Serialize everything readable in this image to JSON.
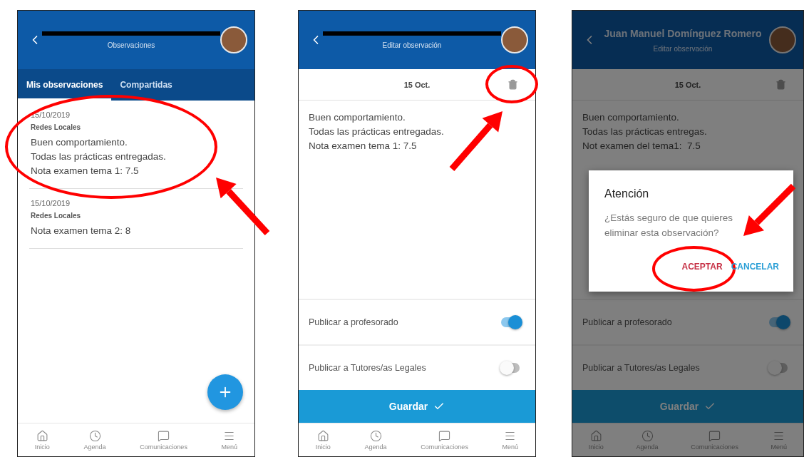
{
  "screens": [
    {
      "kind": "list",
      "header": {
        "redacted": true,
        "subtitle": "Observaciones"
      },
      "tabs": [
        {
          "label": "Mis observaciones",
          "selected": true
        },
        {
          "label": "Compartidas",
          "selected": false
        }
      ],
      "items": [
        {
          "date": "15/10/2019",
          "subject": "Redes Locales",
          "text": "Buen comportamiento.\nTodas las prácticas entregadas.\nNota examen tema 1: 7.5",
          "highlighted": true
        },
        {
          "date": "15/10/2019",
          "subject": "Redes Locales",
          "text": "Nota examen tema 2: 8",
          "highlighted": false
        }
      ],
      "nav": [
        {
          "label": "Inicio"
        },
        {
          "label": "Agenda"
        },
        {
          "label": "Comunicaciones"
        },
        {
          "label": "Menú"
        }
      ]
    },
    {
      "kind": "edit",
      "header": {
        "redacted": true,
        "subtitle": "Editar observación"
      },
      "date": "15 Oct.",
      "trash": {
        "highlighted": true
      },
      "note": "Buen comportamiento.\nTodas las prácticas entregadas.\nNota examen tema 1: 7.5",
      "toggles": [
        {
          "label": "Publicar a profesorado",
          "on": true
        },
        {
          "label": "Publicar a Tutores/as Legales",
          "on": false
        }
      ],
      "save_label": "Guardar",
      "nav": [
        {
          "label": "Inicio"
        },
        {
          "label": "Agenda"
        },
        {
          "label": "Comunicaciones"
        },
        {
          "label": "Menú"
        }
      ]
    },
    {
      "kind": "edit",
      "dimmed": true,
      "header": {
        "redacted": false,
        "title": "Juan Manuel Domínguez Romero",
        "subtitle": "Editar observación"
      },
      "date": "15 Oct.",
      "note": "Buen comportamiento.\nTodas las prácticas entregas.\nNot examen del tema1:  7.5",
      "toggles": [
        {
          "label": "Publicar a profesorado",
          "on": true
        },
        {
          "label": "Publicar a Tutores/as Legales",
          "on": false
        }
      ],
      "save_label": "Guardar",
      "dialog": {
        "title": "Atención",
        "message": "¿Estás seguro de que quieres eliminar esta observación?",
        "buttons": [
          {
            "label": "ACEPTAR",
            "color": "#c62f44",
            "highlighted": true
          },
          {
            "label": "CANCELAR",
            "color": "#2a9fd6",
            "highlighted": false
          }
        ]
      },
      "nav": [
        {
          "label": "Inicio"
        },
        {
          "label": "Agenda"
        },
        {
          "label": "Comunicaciones"
        },
        {
          "label": "Menú"
        }
      ]
    }
  ]
}
